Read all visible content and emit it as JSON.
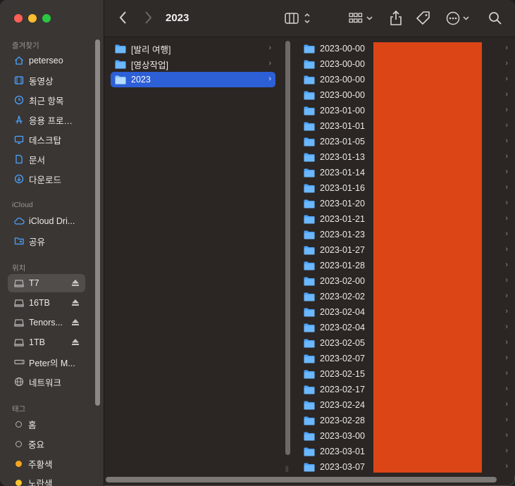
{
  "window": {
    "title": "2023"
  },
  "sidebar": {
    "sections": [
      {
        "title": "즐겨찾기",
        "items": [
          {
            "label": "peterseo",
            "icon": "home-icon"
          },
          {
            "label": "동영상",
            "icon": "film-icon"
          },
          {
            "label": "최근 항목",
            "icon": "clock-icon"
          },
          {
            "label": "응용 프로그램",
            "icon": "apps-icon"
          },
          {
            "label": "데스크탑",
            "icon": "desktop-icon"
          },
          {
            "label": "문서",
            "icon": "document-icon"
          },
          {
            "label": "다운로드",
            "icon": "download-icon"
          }
        ]
      },
      {
        "title": "iCloud",
        "items": [
          {
            "label": "iCloud Dri...",
            "icon": "cloud-icon"
          },
          {
            "label": "공유",
            "icon": "shared-folder-icon"
          }
        ]
      },
      {
        "title": "위치",
        "items": [
          {
            "label": "T7",
            "icon": "drive-icon",
            "eject": true,
            "selected": true
          },
          {
            "label": "16TB",
            "icon": "drive-icon",
            "eject": true
          },
          {
            "label": "Tenors...",
            "icon": "drive-icon",
            "eject": true
          },
          {
            "label": "1TB",
            "icon": "drive-icon",
            "eject": true
          },
          {
            "label": "Peter의 M...",
            "icon": "laptop-drive-icon"
          },
          {
            "label": "네트워크",
            "icon": "network-icon"
          }
        ]
      },
      {
        "title": "태그",
        "items": [
          {
            "label": "홈",
            "icon": "tag-empty-icon"
          },
          {
            "label": "중요",
            "icon": "tag-empty-icon"
          },
          {
            "label": "주황색",
            "icon": "tag-orange-icon",
            "color": "#f5a524"
          },
          {
            "label": "노란색",
            "icon": "tag-yellow-icon",
            "color": "#f7c631"
          }
        ]
      }
    ]
  },
  "column1": [
    {
      "name": "[발리 여행]"
    },
    {
      "name": "[영상작업]"
    },
    {
      "name": "2023",
      "selected": true
    }
  ],
  "column2": [
    "2023-00-00",
    "2023-00-00",
    "2023-00-00",
    "2023-00-00",
    "2023-01-00",
    "2023-01-01",
    "2023-01-05",
    "2023-01-13",
    "2023-01-14",
    "2023-01-16",
    "2023-01-20",
    "2023-01-21",
    "2023-01-23",
    "2023-01-27",
    "2023-01-28",
    "2023-02-00",
    "2023-02-02",
    "2023-02-04",
    "2023-02-04",
    "2023-02-05",
    "2023-02-07",
    "2023-02-15",
    "2023-02-17",
    "2023-02-24",
    "2023-02-28",
    "2023-03-00",
    "2023-03-01",
    "2023-03-07"
  ],
  "colors": {
    "accent": "#2d5fd6",
    "folder": "#4aa3ff",
    "redaction": "#dc4516"
  }
}
